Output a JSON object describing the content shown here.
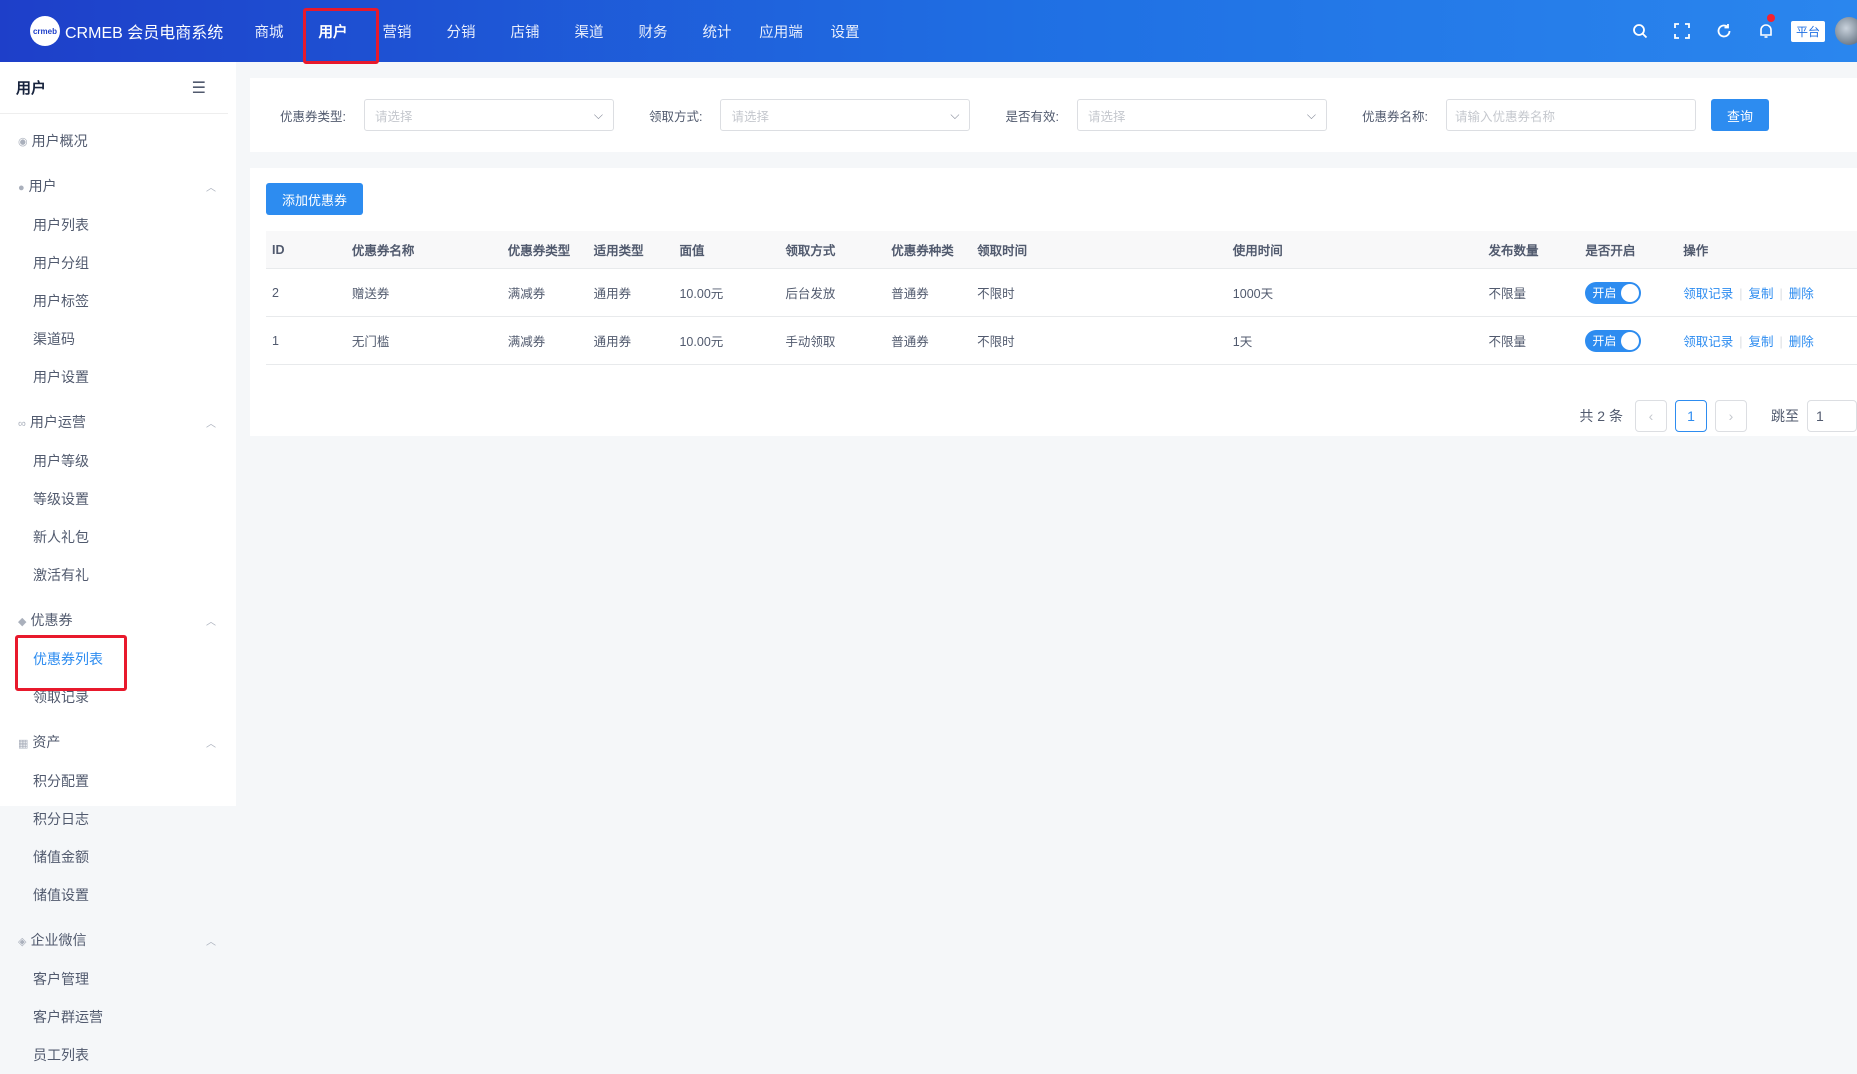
{
  "header": {
    "logo_badge": "crmeb",
    "logo_text": "CRMEB 会员电商系统",
    "nav": [
      "商城",
      "用户",
      "营销",
      "分销",
      "店铺",
      "渠道",
      "财务",
      "统计",
      "应用端",
      "设置"
    ],
    "active_nav_index": 1,
    "platform_label": "平台",
    "icons": [
      "search-icon",
      "fullscreen-icon",
      "refresh-icon",
      "bell-icon"
    ]
  },
  "sidebar": {
    "title": "用户",
    "overview": "用户概况",
    "groups": [
      {
        "label": "用户",
        "items": [
          "用户列表",
          "用户分组",
          "用户标签",
          "渠道码",
          "用户设置"
        ]
      },
      {
        "label": "用户运营",
        "items": [
          "用户等级",
          "等级设置",
          "新人礼包",
          "激活有礼"
        ]
      },
      {
        "label": "优惠券",
        "items": [
          "优惠券列表",
          "领取记录"
        ]
      },
      {
        "label": "资产",
        "items": [
          "积分配置",
          "积分日志",
          "储值金额",
          "储值设置"
        ]
      },
      {
        "label": "企业微信",
        "items": [
          "客户管理",
          "客户群运营",
          "员工列表"
        ]
      }
    ],
    "active_item": "优惠券列表"
  },
  "filters": {
    "type_label": "优惠券类型:",
    "type_placeholder": "请选择",
    "way_label": "领取方式:",
    "way_placeholder": "请选择",
    "valid_label": "是否有效:",
    "valid_placeholder": "请选择",
    "name_label": "优惠券名称:",
    "name_placeholder": "请输入优惠券名称",
    "query_button": "查询"
  },
  "add_button": "添加优惠券",
  "table": {
    "headers": [
      "ID",
      "优惠券名称",
      "优惠券类型",
      "适用类型",
      "面值",
      "领取方式",
      "优惠券种类",
      "领取时间",
      "使用时间",
      "发布数量",
      "是否开启",
      "操作"
    ],
    "rows": [
      {
        "id": "2",
        "name": "赠送券",
        "type": "满减券",
        "apply": "通用券",
        "value": "10.00元",
        "way": "后台发放",
        "kind": "普通券",
        "get_time": "不限时",
        "use_time": "1000天",
        "count": "不限量",
        "switch": "开启"
      },
      {
        "id": "1",
        "name": "无门槛",
        "type": "满减券",
        "apply": "通用券",
        "value": "10.00元",
        "way": "手动领取",
        "kind": "普通券",
        "get_time": "不限时",
        "use_time": "1天",
        "count": "不限量",
        "switch": "开启"
      }
    ],
    "ops": [
      "领取记录",
      "复制",
      "删除"
    ]
  },
  "pager": {
    "total": "共 2 条",
    "current": "1",
    "jump_label": "跳至",
    "jump_value": "1"
  }
}
